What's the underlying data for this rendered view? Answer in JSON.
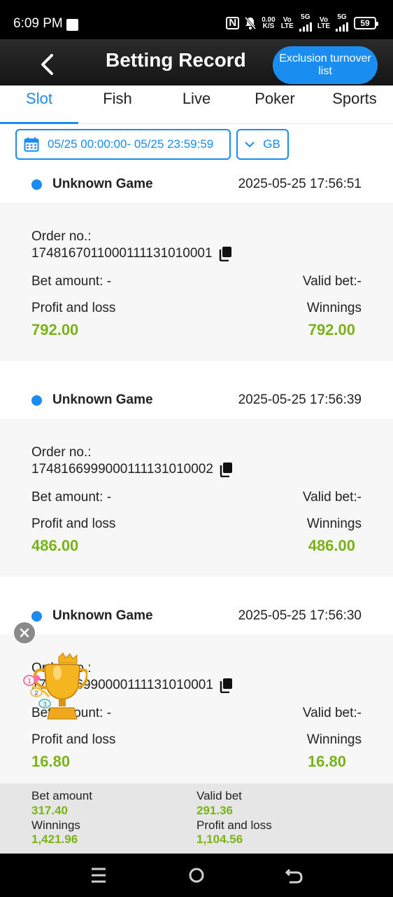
{
  "status_bar": {
    "time": "6:09 PM",
    "net_speed": "0.00",
    "net_unit": "K/S",
    "sim1_top": "Vo",
    "sim1_bottom": "LTE",
    "sim1_net": "5G",
    "sim2_top": "Vo",
    "sim2_bottom": "LTE",
    "sim2_net": "5G",
    "battery": "59"
  },
  "header": {
    "title": "Betting Record",
    "exclusion_button": "Exclusion turnover list"
  },
  "tabs": [
    {
      "label": "Slot",
      "active": true
    },
    {
      "label": "Fish",
      "active": false
    },
    {
      "label": "Live",
      "active": false
    },
    {
      "label": "Poker",
      "active": false
    },
    {
      "label": "Sports",
      "active": false
    }
  ],
  "filters": {
    "date_range": "05/25 00:00:00- 05/25 23:59:59",
    "region": "GB"
  },
  "labels": {
    "order_no": "Order no.:",
    "bet_amount": "Bet amount: -",
    "valid_bet": "Valid bet:-",
    "profit_and_loss": "Profit and loss",
    "winnings": "Winnings"
  },
  "records": [
    {
      "game": "Unknown Game",
      "datetime": "2025-05-25 17:56:51",
      "order_no": "1748167011000111131010001",
      "profit_and_loss": "792.00",
      "winnings": "792.00"
    },
    {
      "game": "Unknown Game",
      "datetime": "2025-05-25 17:56:39",
      "order_no": "1748166999000111131010002",
      "profit_and_loss": "486.00",
      "winnings": "486.00"
    },
    {
      "game": "Unknown Game",
      "datetime": "2025-05-25 17:56:30",
      "order_no": "1748166990000111131010001",
      "profit_and_loss": "16.80",
      "winnings": "16.80"
    }
  ],
  "summary": {
    "bet_amount_label": "Bet amount",
    "bet_amount": "317.40",
    "valid_bet_label": "Valid bet",
    "valid_bet": "291.36",
    "winnings_label": "Winnings",
    "winnings": "1,421.96",
    "profit_and_loss_label": "Profit and loss",
    "profit_and_loss": "1,104.56"
  },
  "colors": {
    "accent": "#1b8bf0",
    "amount_green": "#7ab317",
    "header_bg": "#1a1a1a"
  },
  "icons": {
    "back": "chevron-left-icon",
    "calendar": "calendar-icon",
    "dropdown": "chevron-down-icon",
    "copy": "copy-icon",
    "close": "close-icon",
    "trophy": "trophy-icon"
  }
}
